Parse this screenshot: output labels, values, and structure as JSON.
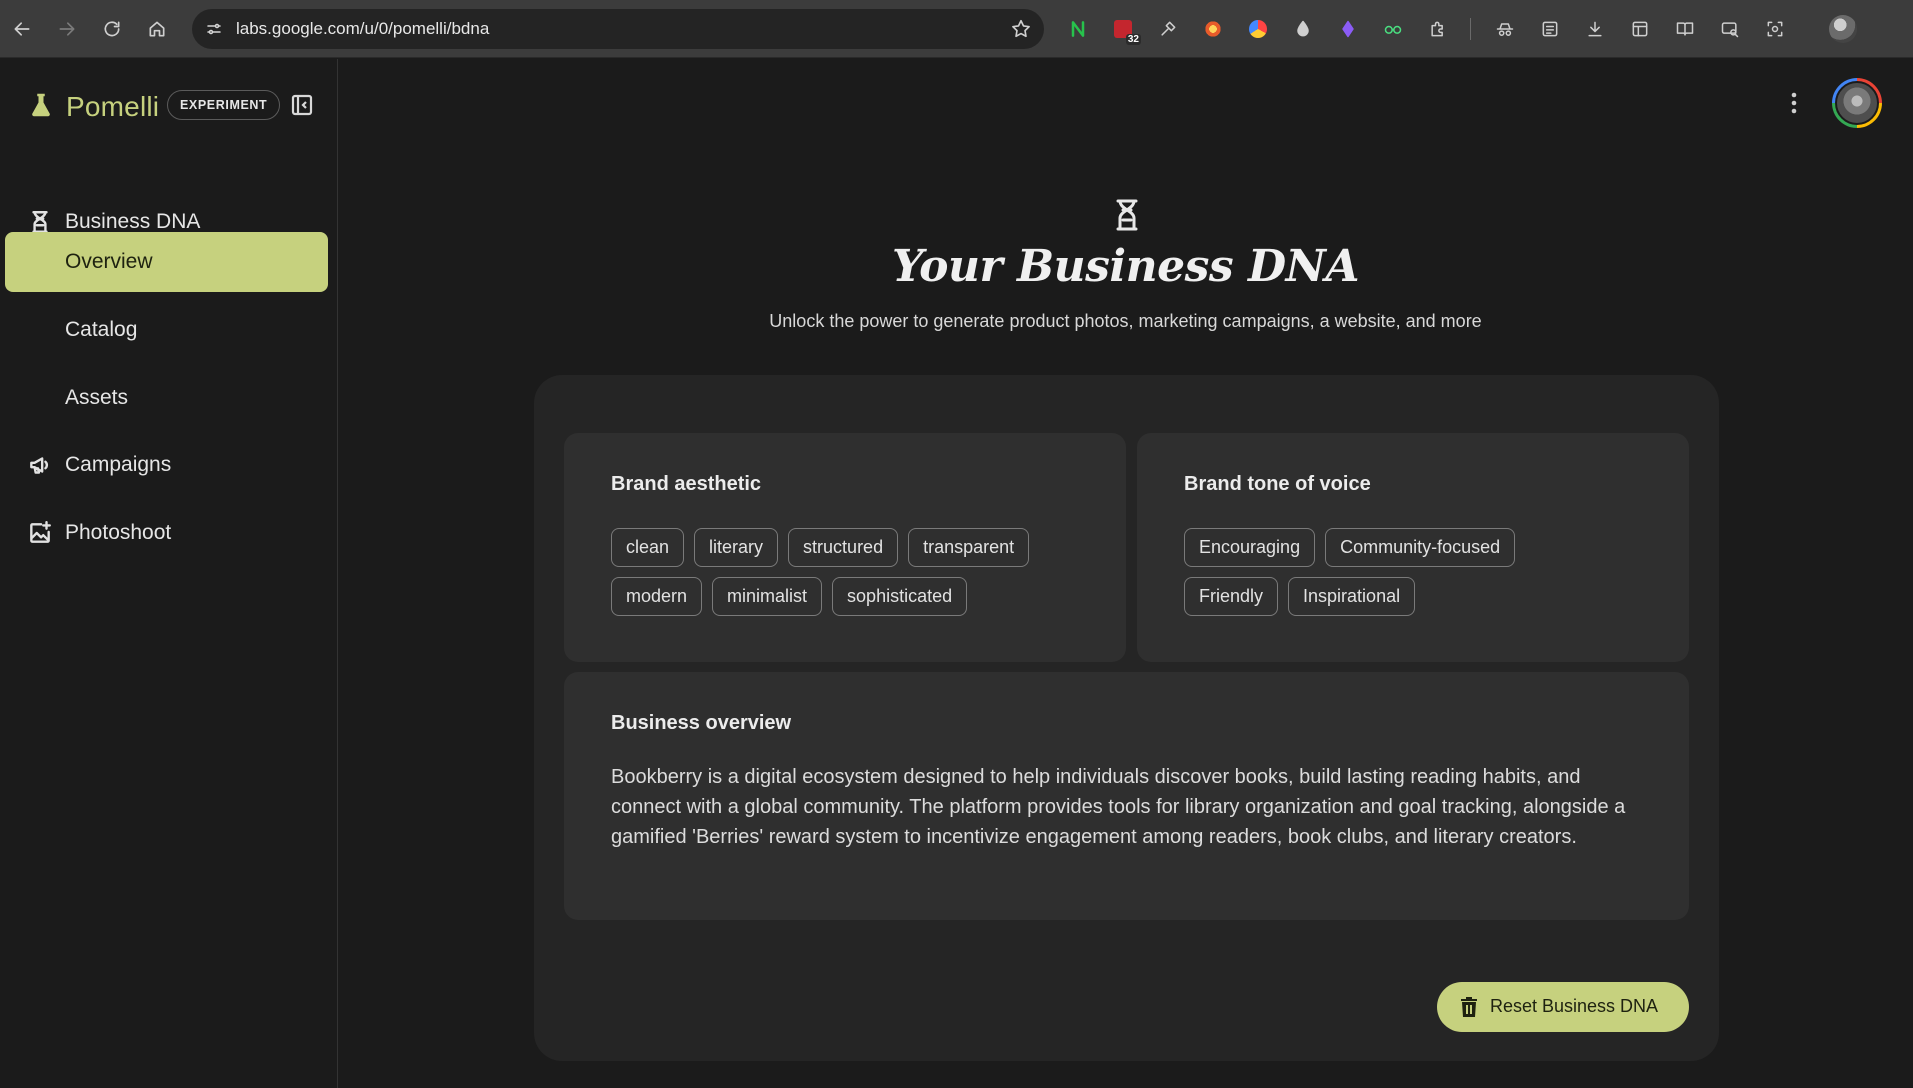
{
  "browser": {
    "url": "labs.google.com/u/0/pomelli/bdna",
    "extension_badge_count": "32"
  },
  "app": {
    "name": "Pomelli",
    "badge": "EXPERIMENT"
  },
  "sidebar": {
    "items": [
      {
        "label": "Business DNA",
        "icon": "dna-icon"
      },
      {
        "label": "Overview",
        "active": true
      },
      {
        "label": "Catalog"
      },
      {
        "label": "Assets"
      },
      {
        "label": "Campaigns",
        "icon": "megaphone-icon"
      },
      {
        "label": "Photoshoot",
        "icon": "photo-sparkle-icon"
      }
    ]
  },
  "hero": {
    "title": "Your Business DNA",
    "subtitle": "Unlock the power to generate product photos, marketing campaigns, a website, and more"
  },
  "aesthetic": {
    "title": "Brand aesthetic",
    "chips": [
      "clean",
      "literary",
      "structured",
      "transparent",
      "modern",
      "minimalist",
      "sophisticated"
    ]
  },
  "tone": {
    "title": "Brand tone of voice",
    "chips": [
      "Encouraging",
      "Community-focused",
      "Friendly",
      "Inspirational"
    ]
  },
  "overview": {
    "title": "Business overview",
    "text": "Bookberry is a digital ecosystem designed to help individuals discover books, build lasting reading habits, and connect with a global community. The platform provides tools for library organization and goal tracking, alongside a gamified 'Berries' reward system to incentivize engagement among readers, book clubs, and literary creators."
  },
  "actions": {
    "reset_label": "Reset Business DNA"
  },
  "colors": {
    "accent": "#c6d17e",
    "background": "#1b1b1b",
    "panel": "#252525",
    "card": "#2f2f2f"
  }
}
